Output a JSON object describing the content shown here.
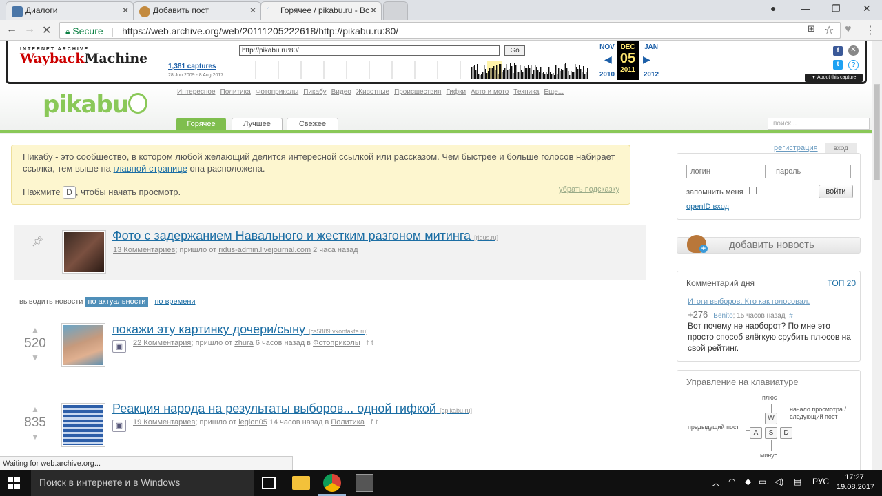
{
  "browser": {
    "tabs": [
      {
        "title": "Диалоги",
        "active": false
      },
      {
        "title": "Добавить пост",
        "active": false
      },
      {
        "title": "Горячее / pikabu.ru - Вс",
        "active": true
      }
    ],
    "secure_label": "Secure",
    "url": "https://web.archive.org/web/20111205222618/http://pikabu.ru:80/"
  },
  "wayback": {
    "logo_top": "INTERNET ARCHIVE",
    "logo_main_left": "Wayback",
    "logo_main_right": "Machine",
    "url_value": "http://pikabu.ru:80/",
    "go_label": "Go",
    "captures": "1,381 captures",
    "range": "28 Jun 2009 - 8 Aug 2017",
    "prev_month": "NOV",
    "prev_year": "2010",
    "cur_month": "DEC",
    "cur_day": "05",
    "cur_year": "2011",
    "next_month": "JAN",
    "next_year": "2012",
    "about": "▼ About this capture"
  },
  "pikabu": {
    "logo": "pikabu",
    "nav": [
      "Интересное",
      "Политика",
      "Фотоприколы",
      "Пикабу",
      "Видео",
      "Животные",
      "Происшествия",
      "Гифки",
      "Авто и мото",
      "Техника",
      "Еще..."
    ],
    "tabs": [
      "Горячее",
      "Лучшее",
      "Свежее"
    ],
    "search_placeholder": "поиск...",
    "hint": {
      "text1": "Пикабу - это сообщество, в котором любой желающий делится интересной ссылкой или рассказом. Чем быстрее и больше голосов набирает ссылка, тем выше на ",
      "link": "главной странице",
      "text2": " она расположена.",
      "press": "Нажмите ",
      "key": "D",
      "press2": ", чтобы начать просмотр.",
      "dismiss": "убрать подсказку"
    },
    "pinned": {
      "title": "Фото с задержанием Навального и жестким разгоном митинга",
      "source": "[ridus.ru]",
      "comments": "13 Комментариев",
      "from_label": "; пришло от ",
      "author": "ridus-admin.livejournal.com",
      "time": " 2 часа назад"
    },
    "sort": {
      "label": "выводить новости",
      "active": "по актуальности",
      "other": "по времени"
    },
    "posts": [
      {
        "votes": "520",
        "title": "покажи эту картинку дочери/сыну",
        "source": "[cs5889.vkontakte.ru]",
        "comments": "22 Комментария",
        "from_label": "; пришло от ",
        "author": "zhura",
        "time": " 6 часов назад в ",
        "category": "Фотоприколы"
      },
      {
        "votes": "835",
        "title": "Реакция народа на результаты выборов... одной гифкой",
        "source": "[apikabu.ru]",
        "comments": "19 Комментариев",
        "from_label": "; пришло от ",
        "author": "legion05",
        "time": " 14 часов назад в ",
        "category": "Политика"
      }
    ],
    "sidebar": {
      "register": "регистрация",
      "login_tab": "вход",
      "login_placeholder": "логин",
      "password_placeholder": "пароль",
      "remember": "запомнить меня",
      "login_button": "войти",
      "openid": "openID вход",
      "add_news": "добавить новость",
      "comment_day": {
        "title": "Комментарий дня",
        "top": "ТОП 20",
        "link": "Итоги выборов. Кто как голосовал.",
        "score": "+276",
        "author": "Benito",
        "time": "; 15 часов назад",
        "hash": "#",
        "text": "Вот почему не наоборот? По мне это просто способ влёгкую срубить плюсов на свой рейтинг."
      },
      "keyboard": {
        "title": "Управление на клавиатуре",
        "plus": "плюс",
        "minus": "минус",
        "prev": "предыдущий пост",
        "next": "начало просмотра / следующий пост",
        "keys": [
          "W",
          "A",
          "S",
          "D"
        ]
      }
    }
  },
  "status": "Waiting for web.archive.org...",
  "taskbar": {
    "search": "Поиск в интернете и в Windows",
    "lang": "РУС",
    "time": "17:27",
    "date": "19.08.2017"
  }
}
